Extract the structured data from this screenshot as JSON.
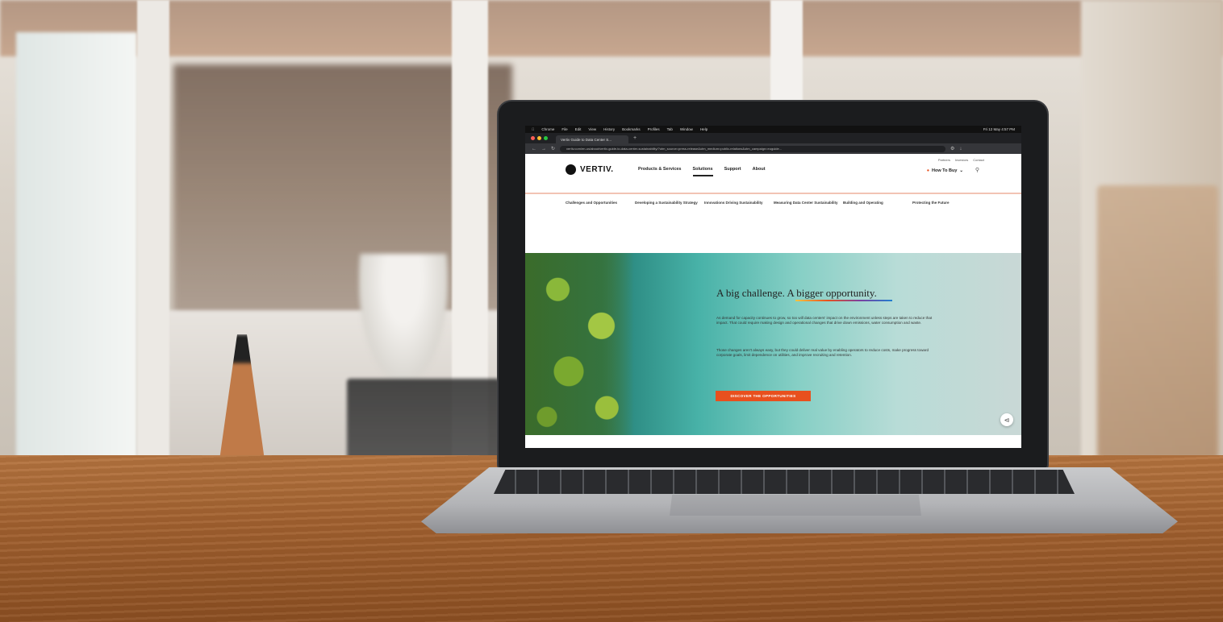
{
  "mac_menu": [
    "Chrome",
    "File",
    "Edit",
    "View",
    "History",
    "Bookmarks",
    "Profiles",
    "Tab",
    "Window",
    "Help"
  ],
  "mac_clock": "Fri 12 May 4:57 PM",
  "browser": {
    "tab_title": "Vertiv Guide to Data Center S...",
    "url": "vertiv.com/en-us/about/vertiv-guide-to-data-center-sustainability/?utm_source=press-release&utm_medium=public-relations&utm_campaign=euguide..."
  },
  "site": {
    "logo": "VERTIV.",
    "nav": [
      "Products & Services",
      "Solutions",
      "Support",
      "About"
    ],
    "active_nav": "Solutions",
    "utility": [
      "Partners",
      "Investors",
      "Contact"
    ],
    "how_to_buy": "How To Buy",
    "subnav": [
      "Challenges and Opportunities",
      "Developing a Sustainability Strategy",
      "Innovations Driving Sustainability",
      "Measuring Data Center Sustainability",
      "Building and Operating",
      "Protecting the Future"
    ],
    "hero": {
      "title": "A big challenge. A bigger opportunity.",
      "p1": "As demand for capacity continues to grow, so too will data centers' impact on the environment unless steps are taken to reduce that impact. That could require making design and operational changes that drive down emissions, water consumption and waste.",
      "p2": "Those changes aren't always easy, but they could deliver real value by enabling operators to reduce costs, make progress toward corporate goals, limit dependence on utilities, and improve recruiting and retention.",
      "cta": "DISCOVER THE OPPORTUNITIES"
    }
  },
  "colors": {
    "accent": "#e8501e",
    "dark": "#111111"
  }
}
